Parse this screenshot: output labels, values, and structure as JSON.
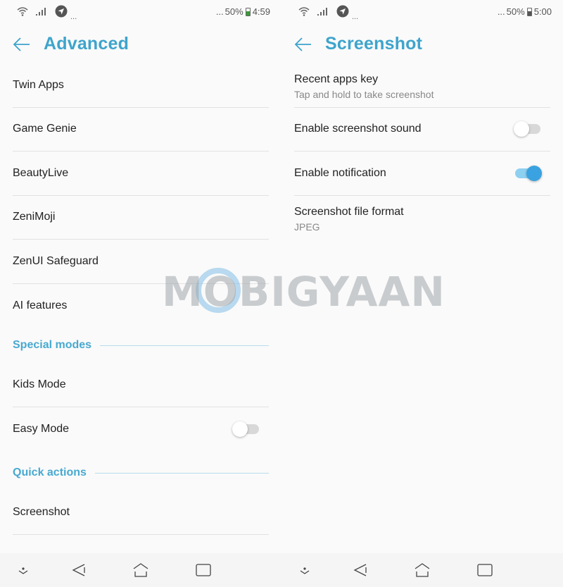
{
  "left": {
    "status": {
      "dots_left": "...",
      "dots_right": "...",
      "battery": "50%",
      "time": "4:59",
      "charging": true
    },
    "title": "Advanced",
    "items_top": [
      {
        "label": "Twin Apps"
      },
      {
        "label": "Game Genie"
      },
      {
        "label": "BeautyLive"
      },
      {
        "label": "ZeniMoji"
      },
      {
        "label": "ZenUI Safeguard"
      },
      {
        "label": "AI features"
      }
    ],
    "sections": [
      {
        "title": "Special modes",
        "items": [
          {
            "label": "Kids Mode"
          },
          {
            "label": "Easy Mode",
            "toggle": false
          }
        ]
      },
      {
        "title": "Quick actions",
        "items": [
          {
            "label": "Screenshot"
          }
        ]
      }
    ]
  },
  "right": {
    "status": {
      "dots_left": "...",
      "dots_right": "...",
      "battery": "50%",
      "time": "5:00",
      "charging": false
    },
    "title": "Screenshot",
    "items": [
      {
        "label": "Recent apps key",
        "sub": "Tap and hold to take screenshot"
      },
      {
        "label": "Enable screenshot sound",
        "toggle": false
      },
      {
        "label": "Enable notification",
        "toggle": true
      },
      {
        "label": "Screenshot file format",
        "sub": "JPEG"
      }
    ]
  },
  "navbar": {
    "icons": [
      "hide-nav-icon",
      "back-icon",
      "home-icon",
      "recents-icon"
    ]
  },
  "watermark": {
    "text": "MOBIGYAAN"
  },
  "colors": {
    "accent": "#3ea4cc",
    "toggle_on": "#3aa2e0",
    "toggle_track_on": "#8ed0f0"
  }
}
